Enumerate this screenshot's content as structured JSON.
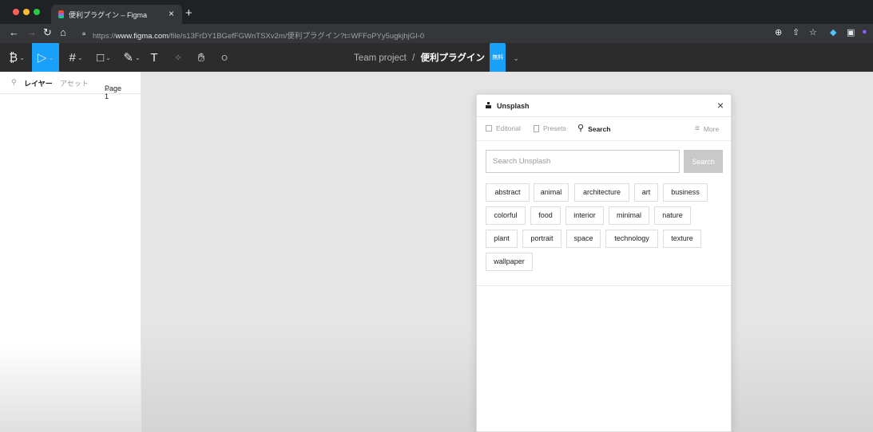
{
  "browser": {
    "tab_title": "便利プラグイン – Figma",
    "tab_close": "×",
    "new_tab": "+",
    "url_prefix": "https://",
    "url_host": "www.figma.com",
    "url_path": "/file/s13FrDY1BGefFGWnTSXv2m/便利プラグイン?t=WFFoPYy5ugkjhjGI-0"
  },
  "toolbar": {
    "team": "Team project",
    "separator": "/",
    "file_name": "便利プラグイン",
    "badge": "無料"
  },
  "layers_panel": {
    "tab_layers": "レイヤー",
    "tab_assets": "アセット",
    "page": "Page 1"
  },
  "plugin": {
    "name": "Unsplash",
    "nav": {
      "editorial": "Editorial",
      "presets": "Presets",
      "search": "Search",
      "more": "More"
    },
    "search_placeholder": "Search Unsplash",
    "search_button": "Search",
    "tags": [
      "abstract",
      "animal",
      "architecture",
      "art",
      "business",
      "colorful",
      "food",
      "interior",
      "minimal",
      "nature",
      "plant",
      "portrait",
      "space",
      "technology",
      "texture",
      "wallpaper"
    ]
  },
  "colors": {
    "figma_blue": "#18a0fb",
    "toolbar_bg": "#2c2c2c"
  }
}
